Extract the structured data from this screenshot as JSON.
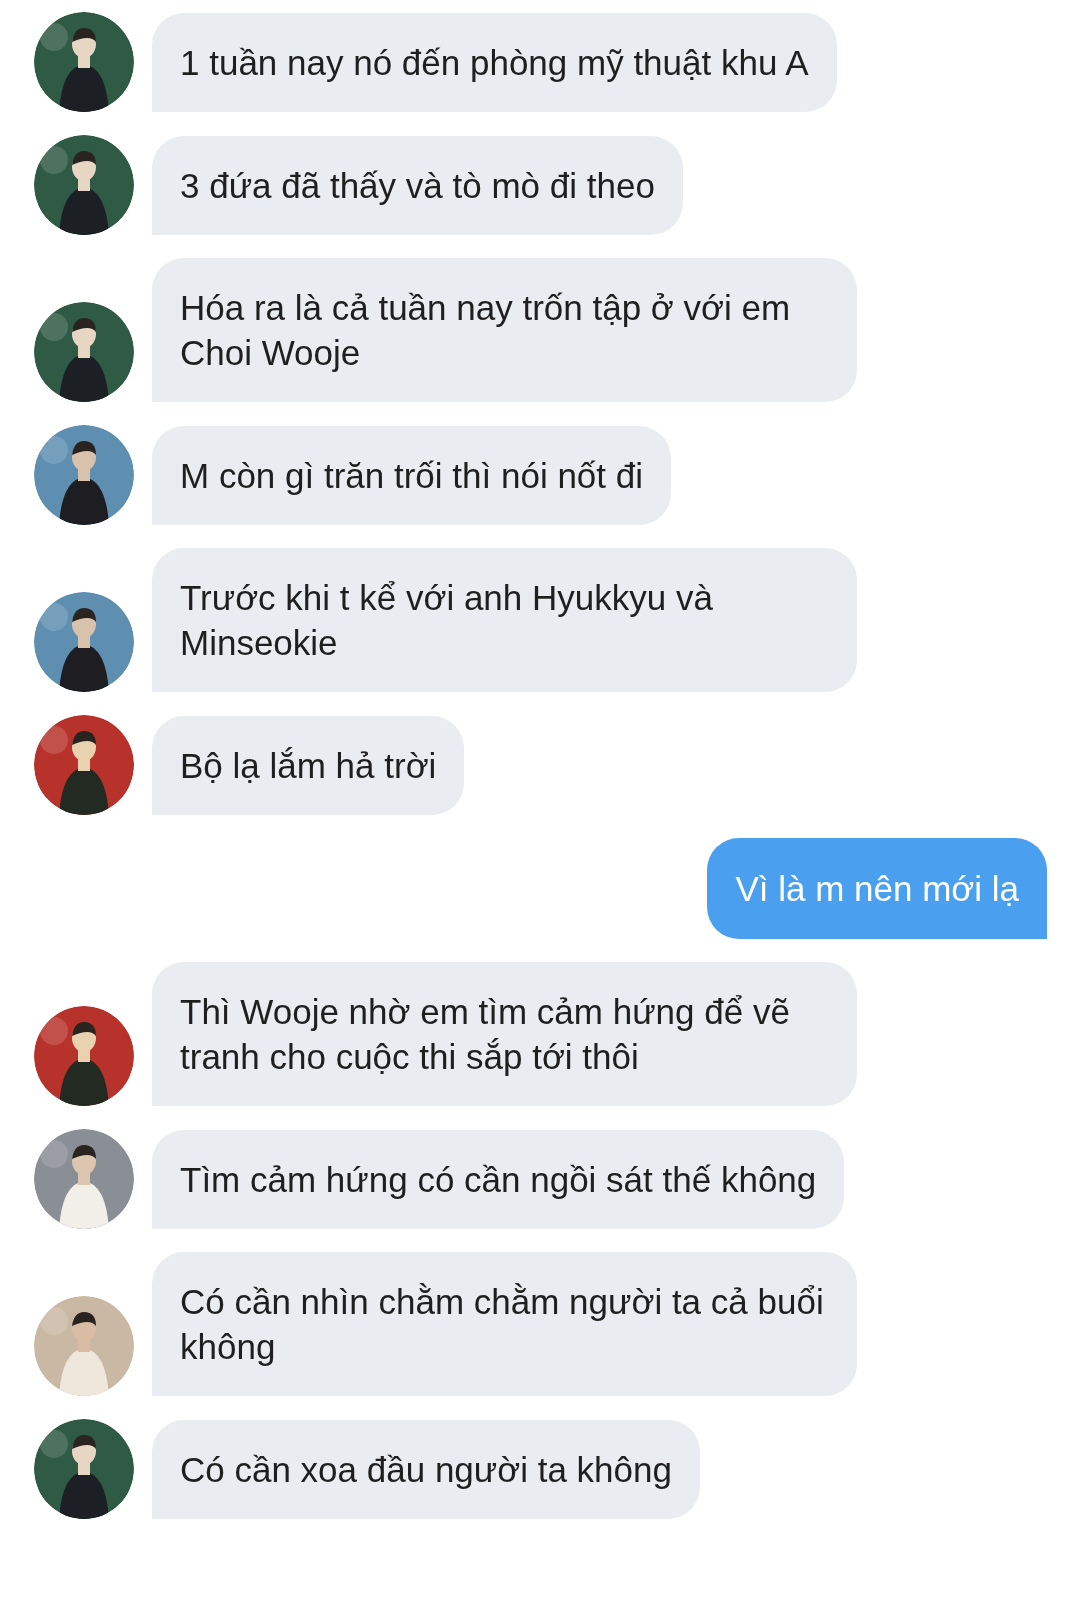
{
  "messages": [
    {
      "kind": "incoming",
      "text": "1 tuần nay nó đến phòng mỹ thuật khu A"
    },
    {
      "kind": "incoming",
      "text": "3 đứa đã thấy và tò mò đi theo"
    },
    {
      "kind": "incoming",
      "text": "Hóa ra là cả tuần nay trốn tập ở với em Choi Wooje"
    },
    {
      "kind": "incoming",
      "text": "M còn gì trăn trối thì nói nốt đi"
    },
    {
      "kind": "incoming",
      "text": "Trước khi t kể với anh Hyukkyu và Minseokie"
    },
    {
      "kind": "incoming",
      "text": "Bộ lạ lắm hả trời"
    },
    {
      "kind": "outgoing",
      "text": "Vì là m nên mới lạ"
    },
    {
      "kind": "incoming",
      "text": "Thì Wooje nhờ em tìm cảm hứng để vẽ tranh cho cuộc thi sắp tới thôi"
    },
    {
      "kind": "incoming",
      "text": "Tìm cảm hứng có cần ngồi sát thế không"
    },
    {
      "kind": "incoming",
      "text": "Có cần nhìn chằm chằm người ta cả buổi không"
    },
    {
      "kind": "incoming",
      "text": "Có cần xoa đầu người ta không"
    }
  ]
}
